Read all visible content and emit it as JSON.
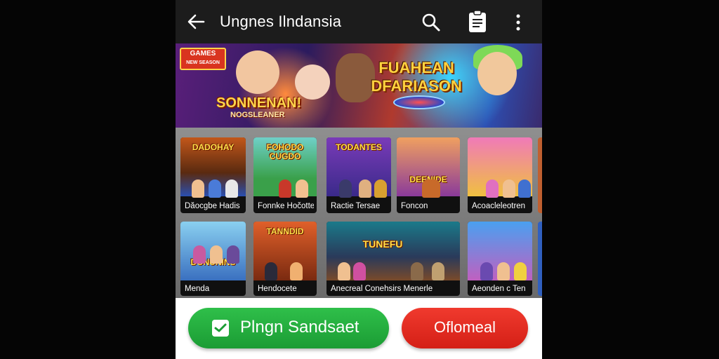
{
  "app_bar": {
    "title": "Ungnes Ilndansia",
    "back_icon": "arrow-left-icon",
    "search_icon": "search-icon",
    "clipboard_icon": "clipboard-icon",
    "more_icon": "more-vertical-icon"
  },
  "banner": {
    "badge_line1": "GAMES",
    "badge_line2": "NEW SEASON",
    "headline": "FUAHEAN DFARIASON",
    "subtitle": "SONNENAN!",
    "subtitle2": "NOGSLEANER"
  },
  "games": [
    {
      "art_title": "DADOHAY",
      "label": "Dăocgbe Hadis"
    },
    {
      "art_title": "FOHODO CUGDO",
      "label": "Fonnke Hočotte"
    },
    {
      "art_title": "TODANTES",
      "label": "Ractie Tersae"
    },
    {
      "art_title": "DEENIDE",
      "label": "Foncon"
    },
    {
      "art_title": "",
      "label": "Acoacleleotren"
    },
    {
      "art_title": "DONUNINS",
      "label": "Menda"
    },
    {
      "art_title": "TANNDID",
      "label": "Hendocete"
    },
    {
      "art_title": "TUNEFU",
      "label": "Anecreal Conehsirs Menerle"
    },
    {
      "art_title": "",
      "label": "Aeonden c Ten"
    }
  ],
  "actions": {
    "primary_label": "Plngn Sandsaet",
    "secondary_label": "Oflomeal"
  },
  "colors": {
    "primary_button": "#22ab3d",
    "secondary_button": "#e42a20",
    "app_bar": "#1c1c1c"
  }
}
